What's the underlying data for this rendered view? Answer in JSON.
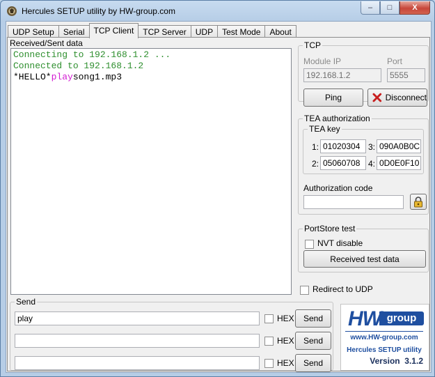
{
  "window": {
    "title": "Hercules SETUP utility by HW-group.com",
    "minimize": "–",
    "maximize": "□",
    "close": "X"
  },
  "tabs": [
    "UDP Setup",
    "Serial",
    "TCP Client",
    "TCP Server",
    "UDP",
    "Test Mode",
    "About"
  ],
  "active_tab": "TCP Client",
  "received": {
    "label": "Received/Sent data",
    "line1": "Connecting to 192.168.1.2 ...",
    "line2": "Connected to 192.168.1.2",
    "line3_pre": "*HELLO*",
    "line3_hl": "play",
    "line3_post": "song1.mp3"
  },
  "tcp": {
    "legend": "TCP",
    "module_ip_label": "Module IP",
    "module_ip": "192.168.1.2",
    "port_label": "Port",
    "port": "5555",
    "ping_label": "Ping",
    "disconnect_label": "Disconnect"
  },
  "tea": {
    "legend": "TEA authorization",
    "key_legend": "TEA key",
    "keys": [
      {
        "n": "1:",
        "v": "01020304"
      },
      {
        "n": "3:",
        "v": "090A0B0C"
      },
      {
        "n": "2:",
        "v": "05060708"
      },
      {
        "n": "4:",
        "v": "0D0E0F10"
      }
    ],
    "auth_label": "Authorization code",
    "auth_value": ""
  },
  "portstore": {
    "legend": "PortStore test",
    "nvt_label": "NVT disable",
    "received_btn": "Received test data"
  },
  "redirect_label": "Redirect to UDP",
  "send": {
    "legend": "Send",
    "rows": [
      {
        "value": "play",
        "hex": "HEX",
        "button": "Send"
      },
      {
        "value": "",
        "hex": "HEX",
        "button": "Send"
      },
      {
        "value": "",
        "hex": "HEX",
        "button": "Send"
      }
    ]
  },
  "logo": {
    "hw": "HW",
    "group": "group",
    "url": "www.HW-group.com",
    "product": "Hercules SETUP utility",
    "version": "Version  3.1.2"
  },
  "colors": {
    "connected_text": "#2f8f2f",
    "highlight_text": "#d21bd2",
    "logo_blue": "#1f4fa0"
  }
}
